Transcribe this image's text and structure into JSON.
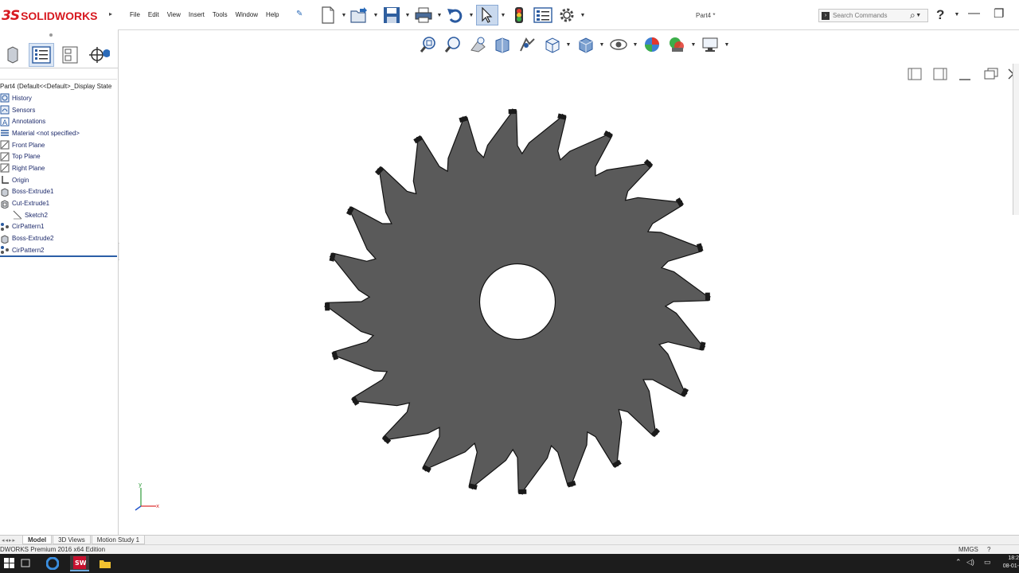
{
  "app": {
    "logo_ds": "3S",
    "logo_text": "SOLIDWORKS",
    "document_title": "Part4 *"
  },
  "menu": [
    "File",
    "Edit",
    "View",
    "Insert",
    "Tools",
    "Window",
    "Help"
  ],
  "search": {
    "placeholder": "Search Commands",
    "help_label": "?"
  },
  "feature_tree": {
    "root": "Part4 (Default<<Default>_Display State",
    "items": [
      {
        "label": "History",
        "icon": "history-icon"
      },
      {
        "label": "Sensors",
        "icon": "sensors-icon"
      },
      {
        "label": "Annotations",
        "icon": "annotations-icon"
      },
      {
        "label": "Material <not specified>",
        "icon": "material-icon"
      },
      {
        "label": "Front Plane",
        "icon": "plane-icon"
      },
      {
        "label": "Top Plane",
        "icon": "plane-icon"
      },
      {
        "label": "Right Plane",
        "icon": "plane-icon"
      },
      {
        "label": "Origin",
        "icon": "origin-icon"
      },
      {
        "label": "Boss-Extrude1",
        "icon": "extrude-icon"
      },
      {
        "label": "Cut-Extrude1",
        "icon": "cut-extrude-icon"
      },
      {
        "label": "Sketch2",
        "icon": "sketch-icon",
        "sub": true
      },
      {
        "label": "CirPattern1",
        "icon": "pattern-icon"
      },
      {
        "label": "Boss-Extrude2",
        "icon": "extrude-icon"
      },
      {
        "label": "CirPattern2",
        "icon": "pattern-icon"
      }
    ]
  },
  "triad": {
    "x": "x",
    "y": "y"
  },
  "model": {
    "teeth": 24,
    "hole_ratio": 0.18,
    "fill_color": "#5a5a5a",
    "edge_color": "#111111"
  },
  "bottom_tabs": [
    "Model",
    "3D Views",
    "Motion Study 1"
  ],
  "status": {
    "product": "DWORKS Premium 2016 x64 Edition",
    "units": "MMGS",
    "help_glyph": "?"
  },
  "taskbar": {
    "time": "18:2",
    "date": "08-01-"
  },
  "colors": {
    "accent": "#2b5ea7",
    "brand": "#d71920"
  }
}
